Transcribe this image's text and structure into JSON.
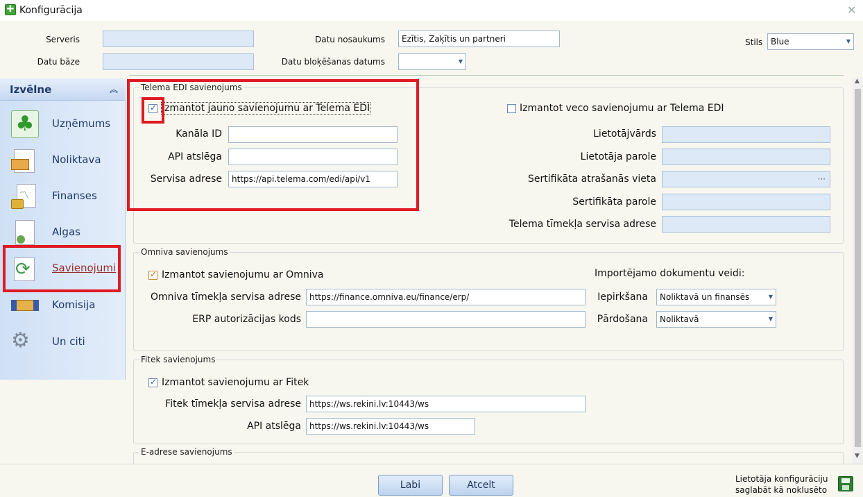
{
  "window": {
    "title": "Konfigurācija"
  },
  "top": {
    "serveris_label": "Serveris",
    "serveris_value": "",
    "datu_baze_label": "Datu bāze",
    "datu_baze_value": "",
    "datu_nosaukums_label": "Datu nosaukums",
    "datu_nosaukums_value": "Ezītis, Zaķītis un partneri",
    "bloksanas_label": "Datu bloķēšanas datums",
    "bloksanas_value": "",
    "stils_label": "Stils",
    "stils_value": "Blue"
  },
  "sidebar": {
    "header": "Izvēlne",
    "items": [
      {
        "label": "Uzņēmums",
        "icon": "clover-icon"
      },
      {
        "label": "Noliktava",
        "icon": "warehouse-icon"
      },
      {
        "label": "Finanses",
        "icon": "finance-icon"
      },
      {
        "label": "Algas",
        "icon": "salary-icon"
      },
      {
        "label": "Savienojumi",
        "icon": "connections-icon",
        "active": true
      },
      {
        "label": "Komisija",
        "icon": "handshake-icon"
      },
      {
        "label": "Un citi",
        "icon": "gears-icon"
      }
    ]
  },
  "telema": {
    "title": "Telema EDI savienojums",
    "new_checkbox_label": "Izmantot jauno savienojumu ar Telema EDI",
    "new_checked": true,
    "kanala_id_label": "Kanāla ID",
    "kanala_id_value": "",
    "api_label": "API atslēga",
    "api_value": "",
    "servisa_label": "Servisa adrese",
    "servisa_value": "https://api.telema.com/edi/api/v1",
    "old_checkbox_label": "Izmantot veco savienojumu ar Telema EDI",
    "old_checked": false,
    "lietotajvards_label": "Lietotājvārds",
    "lietotaja_parole_label": "Lietotāja parole",
    "sert_vieta_label": "Sertifikāta atrašanās vieta",
    "sert_vieta_btn": "···",
    "sert_parole_label": "Sertifikāta parole",
    "timekla_label": "Telema tīmekļa servisa adrese"
  },
  "omniva": {
    "title": "Omniva savienojums",
    "checkbox_label": "Izmantot savienojumu ar Omniva",
    "checked": true,
    "url_label": "Omniva tīmekļa servisa adrese",
    "url_value": "https://finance.omniva.eu/finance/erp/",
    "erp_label": "ERP autorizācijas kods",
    "erp_value": "",
    "import_label": "Importējamo dokumentu veidi:",
    "iepirksana_label": "Iepirkšana",
    "iepirksana_value": "Noliktavā un finansēs",
    "pardosana_label": "Pārdošana",
    "pardosana_value": "Noliktavā"
  },
  "fitek": {
    "title": "Fitek savienojums",
    "checkbox_label": "Izmantot savienojumu ar Fitek",
    "checked": true,
    "url_label": "Fitek tīmekļa servisa adrese",
    "url_value": "https://ws.rekini.lv:10443/ws",
    "api_label": "API atslēga",
    "api_value": "https://ws.rekini.lv:10443/ws"
  },
  "eadrese": {
    "title": "E-adrese savienojums"
  },
  "footer": {
    "ok_label": "Labi",
    "cancel_label": "Atcelt",
    "save_default_label_1": "Lietotāja konfigurāciju",
    "save_default_label_2": "saglabāt kā noklusēto"
  },
  "colors": {
    "highlight": "#e01a22",
    "sidebar_bg": "#d5e4f7",
    "accent": "#1f3a6b"
  }
}
